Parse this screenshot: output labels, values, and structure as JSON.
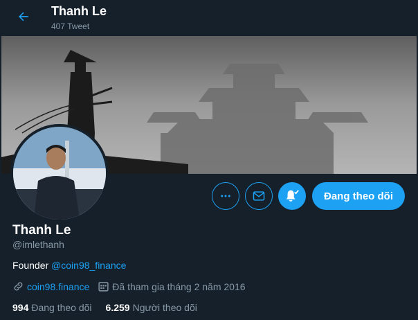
{
  "header": {
    "title": "Thanh Le",
    "tweet_count": "407 Tweet"
  },
  "profile": {
    "name": "Thanh Le",
    "handle": "@imlethanh",
    "bio_text": "Founder",
    "bio_mention": "@coin98_finance",
    "website": "coin98.finance",
    "joined": "Đã tham gia tháng 2 năm 2016"
  },
  "actions": {
    "follow_label": "Đang theo dõi"
  },
  "stats": {
    "following_count": "994",
    "following_label": "Đang theo dõi",
    "followers_count": "6.259",
    "followers_label": "Người theo dõi"
  },
  "colors": {
    "background": "#15202b",
    "accent": "#1da1f2",
    "muted": "#8899a6"
  },
  "icons": {
    "back": "arrow-left-icon",
    "more": "more-dots-icon",
    "message": "envelope-icon",
    "notifications": "bell-check-icon",
    "website": "link-icon",
    "joined": "calendar-icon"
  }
}
